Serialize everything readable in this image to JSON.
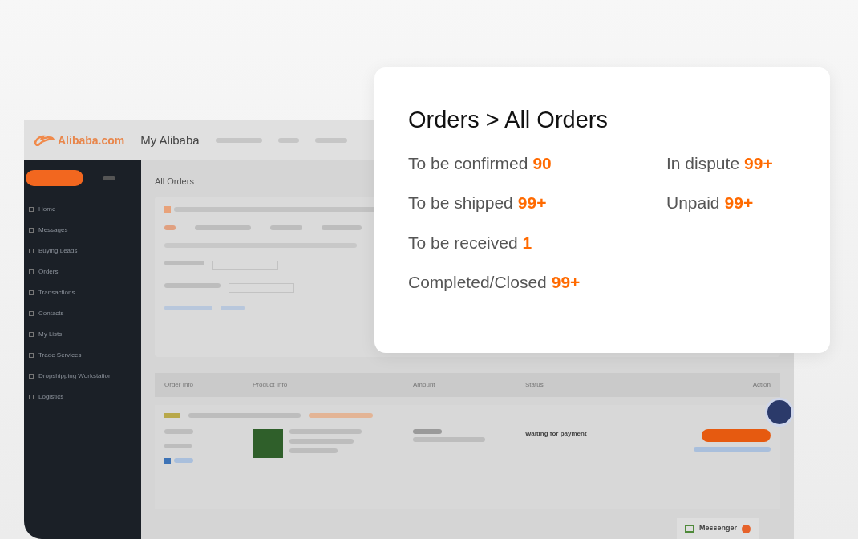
{
  "header": {
    "logo": "Alibaba.com",
    "title": "My Alibaba"
  },
  "sidebar": {
    "items": [
      {
        "label": "Home"
      },
      {
        "label": "Messages"
      },
      {
        "label": "Buying Leads"
      },
      {
        "label": "Orders"
      },
      {
        "label": "Transactions"
      },
      {
        "label": "Contacts"
      },
      {
        "label": "My Lists"
      },
      {
        "label": "Trade Services"
      },
      {
        "label": "Dropshipping Workstation"
      },
      {
        "label": "Logistics"
      }
    ]
  },
  "main": {
    "title": "All Orders",
    "columns": [
      "Order Info",
      "Product Info",
      "Amount",
      "Status",
      "Action"
    ],
    "order": {
      "status": "Waiting for payment"
    }
  },
  "messenger": {
    "label": "Messenger"
  },
  "card": {
    "title": "Orders > All Orders",
    "left": [
      {
        "label": "To be confirmed",
        "count": "90"
      },
      {
        "label": "To be shipped",
        "count": "99+"
      },
      {
        "label": "To be received",
        "count": "1"
      },
      {
        "label": "Completed/Closed",
        "count": "99+"
      }
    ],
    "right": [
      {
        "label": "In dispute",
        "count": "99+"
      },
      {
        "label": "Unpaid",
        "count": "99+"
      }
    ]
  }
}
